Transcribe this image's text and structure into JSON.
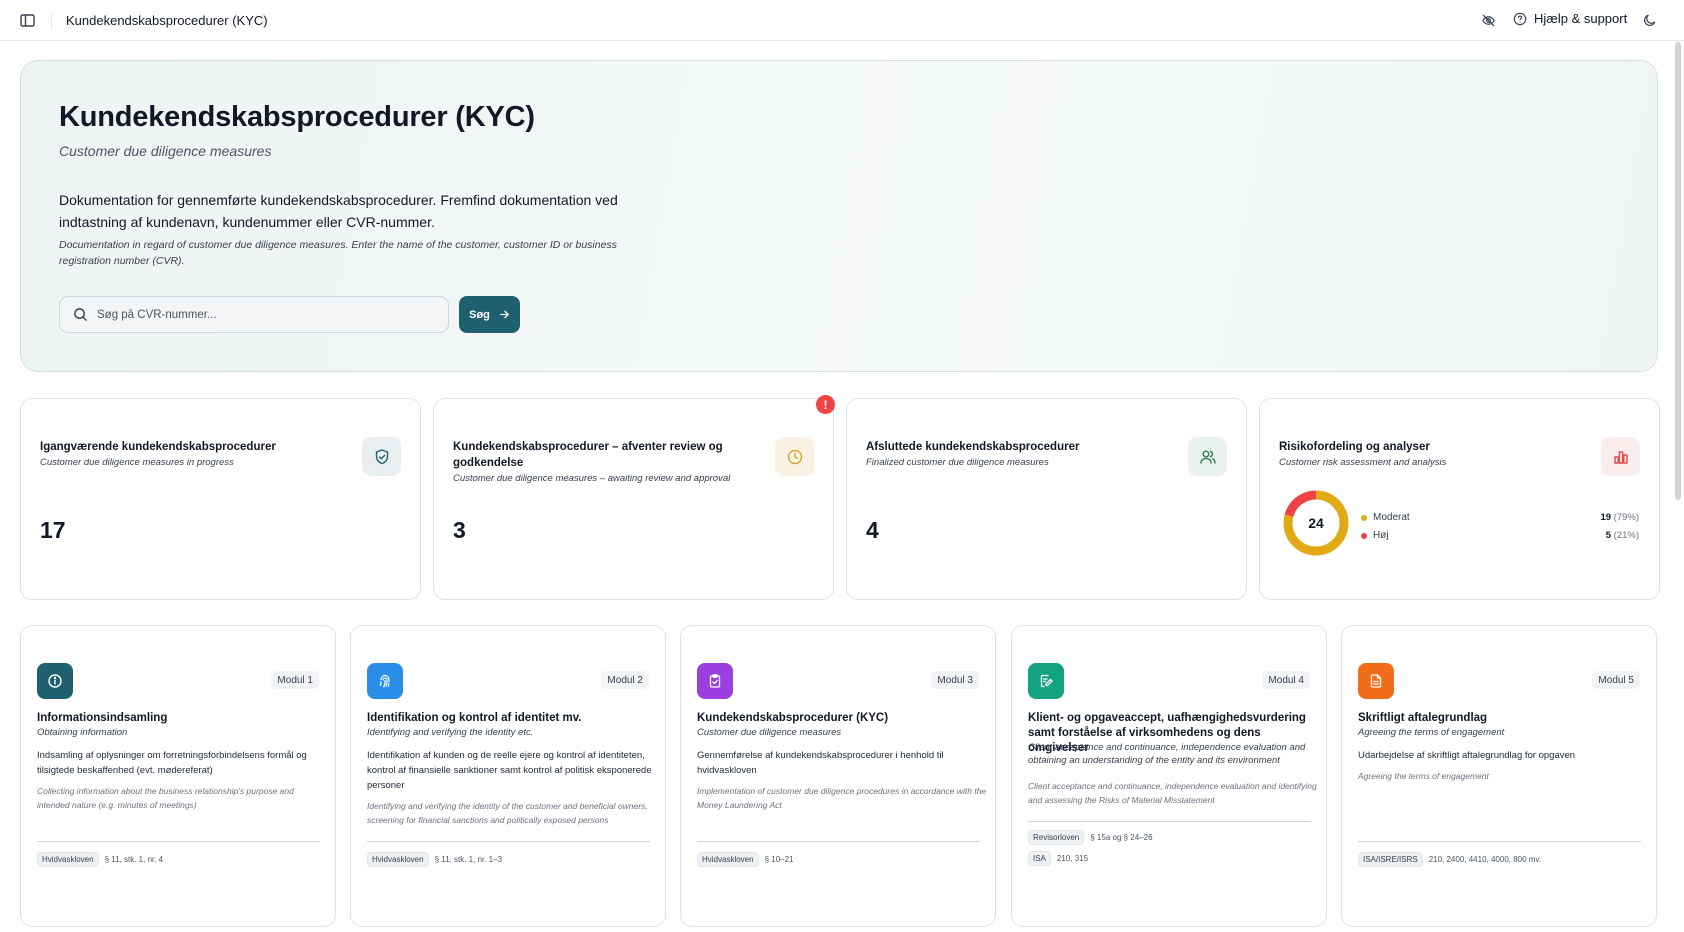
{
  "topbar": {
    "title": "Kundekendskabsprocedurer (KYC)",
    "help_label": "Hjælp & support"
  },
  "hero": {
    "title": "Kundekendskabsprocedurer (KYC)",
    "subtitle": "Customer due diligence measures",
    "description": "Dokumentation for gennemførte kundekendskabsprocedurer. Fremfind dokumentation ved indtastning af kundenavn, kundenummer eller CVR-nummer.",
    "description_en": "Documentation in regard of customer due diligence measures. Enter the name of the customer, customer ID or business registration number (CVR).",
    "search_placeholder": "Søg på CVR-nummer...",
    "search_value": "",
    "search_button": "Søg"
  },
  "cards": [
    {
      "title": "Igangværende kundekendskabsprocedurer",
      "subtitle": "Customer due diligence measures in progress",
      "count": "17",
      "icon": "shield-icon",
      "accent": "#1f5f6f"
    },
    {
      "title": "Kundekendskabsprocedurer – afventer review og godkendelse",
      "subtitle": "Customer due diligence measures – awaiting review and approval",
      "count": "3",
      "icon": "clock-icon",
      "accent": "#d4a437",
      "alert": "!"
    },
    {
      "title": "Afsluttede kundekendskabsprocedurer",
      "subtitle": "Finalized customer due diligence measures",
      "count": "4",
      "icon": "users-icon",
      "accent": "#2e7d5b"
    },
    {
      "title": "Risikofordeling og analyser",
      "subtitle": "Customer risk assessment and analysis",
      "icon": "bar-chart-icon",
      "accent": "#dc4b4b"
    }
  ],
  "risk": {
    "total": "24",
    "items": [
      {
        "label": "Moderat",
        "count": "19",
        "pct": "(79%)",
        "value": 19,
        "color": "#e0a915"
      },
      {
        "label": "Høj",
        "count": "5",
        "pct": "(21%)",
        "value": 5,
        "color": "#ef4444"
      }
    ]
  },
  "modules": [
    {
      "badge": "Modul 1",
      "title": "Informationsindsamling",
      "subtitle": "Obtaining information",
      "desc": "Indsamling af oplysninger om forretningsforbindelsens formål og tilsigtede beskaffenhed (evt. mødereferat)",
      "desc_en": "Collecting information about the business relationship's purpose and intended nature (e.g. minutes of meetings)",
      "icon": "info-icon",
      "color": "#1f5f6f",
      "laws": [
        {
          "tag": "Hvidvaskloven",
          "ref": "§ 11, stk. 1, nr. 4"
        }
      ]
    },
    {
      "badge": "Modul 2",
      "title": "Identifikation og kontrol af identitet mv.",
      "subtitle": "Identifying and verifying the identity etc.",
      "desc": "Identifikation af kunden og de reelle ejere og kontrol af identiteten, kontrol af finansielle sanktioner samt kontrol af politisk eksponerede personer",
      "desc_en": "Identifying and verifying the identity of the customer and beneficial owners, screening for financial sanctions and politically exposed persons",
      "icon": "fingerprint-icon",
      "color": "#2a8ee8",
      "laws": [
        {
          "tag": "Hvidvaskloven",
          "ref": "§ 11, stk. 1, nr. 1–3"
        }
      ]
    },
    {
      "badge": "Modul 3",
      "title": "Kundekendskabsprocedurer (KYC)",
      "subtitle": "Customer due diligence measures",
      "desc": "Gennemførelse af kundekendskabsprocedurer i henhold til hvidvaskloven",
      "desc_en": "Implementation of customer due diligence procedures in accordance with the Money Laundering Act",
      "icon": "clipboard-check-icon",
      "color": "#9b3fe0",
      "laws": [
        {
          "tag": "Hvidvaskloven",
          "ref": "§ 10–21"
        }
      ]
    },
    {
      "badge": "Modul 4",
      "title": "Klient- og opgaveaccept, uafhængighedsvurdering samt forståelse af virksomhedens og dens omgivelser",
      "subtitle": "Client acceptance and continuance, independence evaluation and obtaining an understanding of the entity and its environment",
      "desc": "",
      "desc_en": "Client acceptance and continuance, independence evaluation and identifying and assessing the Risks of Material Misstatement",
      "icon": "file-edit-icon",
      "color": "#14a37f",
      "laws": [
        {
          "tag": "Revisorloven",
          "ref": "§ 15a og § 24–26"
        },
        {
          "tag": "ISA",
          "ref": "210, 315"
        }
      ]
    },
    {
      "badge": "Modul 5",
      "title": "Skriftligt aftalegrundlag",
      "subtitle": "Agreeing the terms of engagement",
      "desc": "Udarbejdelse af skriftligt aftalegrundlag for opgaven",
      "desc_en": "Agreeing the terms of engagement",
      "icon": "document-icon",
      "color": "#f26d1a",
      "laws": [
        {
          "tag": "ISA/ISRE/ISRS",
          "ref": "210, 2400, 4410, 4000, 800 mv."
        }
      ]
    }
  ]
}
